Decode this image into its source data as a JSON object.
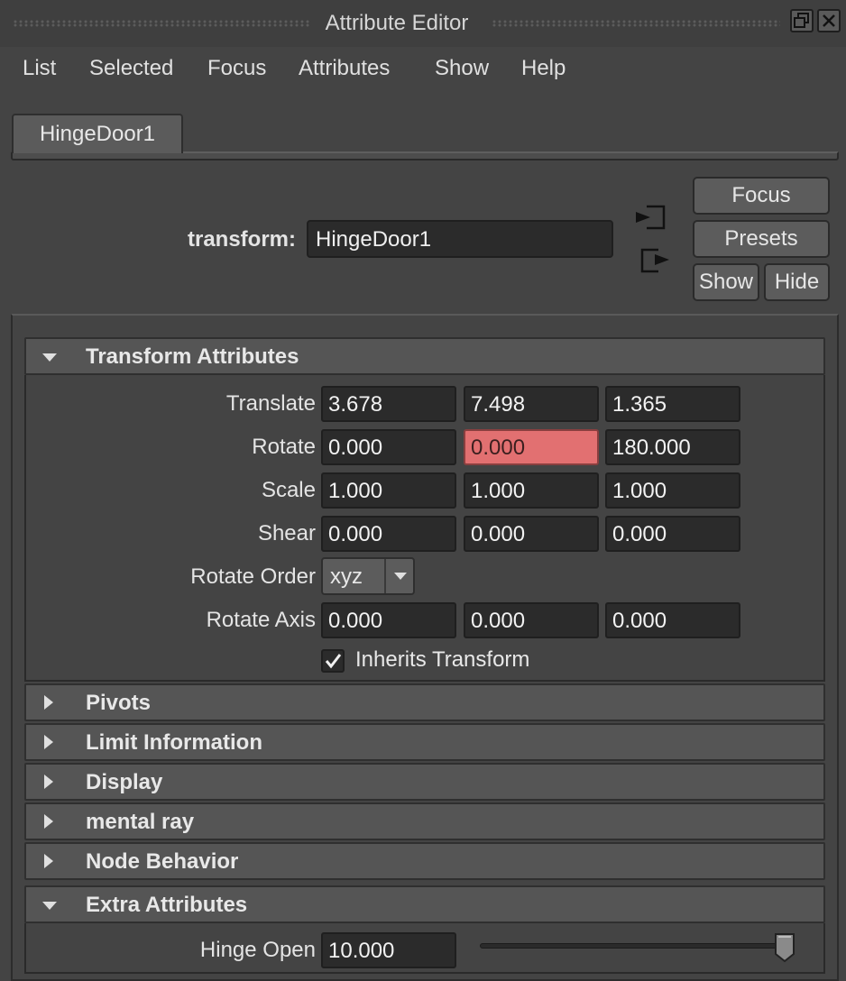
{
  "window": {
    "title": "Attribute Editor"
  },
  "menu": [
    "List",
    "Selected",
    "Focus",
    "Attributes",
    "Show",
    "Help"
  ],
  "tab": {
    "label": "HingeDoor1"
  },
  "node": {
    "type_label": "transform:",
    "name": "HingeDoor1"
  },
  "buttons": {
    "focus": "Focus",
    "presets": "Presets",
    "show": "Show",
    "hide": "Hide"
  },
  "sections": {
    "transform": {
      "title": "Transform Attributes",
      "expanded": true,
      "translate": {
        "label": "Translate",
        "x": "3.678",
        "y": "7.498",
        "z": "1.365"
      },
      "rotate": {
        "label": "Rotate",
        "x": "0.000",
        "y": "0.000",
        "z": "180.000",
        "keyed_color": "#e27071"
      },
      "scale": {
        "label": "Scale",
        "x": "1.000",
        "y": "1.000",
        "z": "1.000"
      },
      "shear": {
        "label": "Shear",
        "x": "0.000",
        "y": "0.000",
        "z": "0.000"
      },
      "rotate_order": {
        "label": "Rotate Order",
        "value": "xyz"
      },
      "rotate_axis": {
        "label": "Rotate Axis",
        "x": "0.000",
        "y": "0.000",
        "z": "0.000"
      },
      "inherits_transform": {
        "label": "Inherits Transform",
        "checked": true
      }
    },
    "pivots": {
      "title": "Pivots",
      "expanded": false
    },
    "limit": {
      "title": "Limit Information",
      "expanded": false
    },
    "display": {
      "title": "Display",
      "expanded": false
    },
    "mental_ray": {
      "title": "mental ray",
      "expanded": false
    },
    "node_behavior": {
      "title": "Node Behavior",
      "expanded": false
    },
    "extra": {
      "title": "Extra Attributes",
      "expanded": true,
      "hinge_open": {
        "label": "Hinge Open",
        "value": "10.000",
        "slider_fraction": 1.0
      }
    }
  }
}
